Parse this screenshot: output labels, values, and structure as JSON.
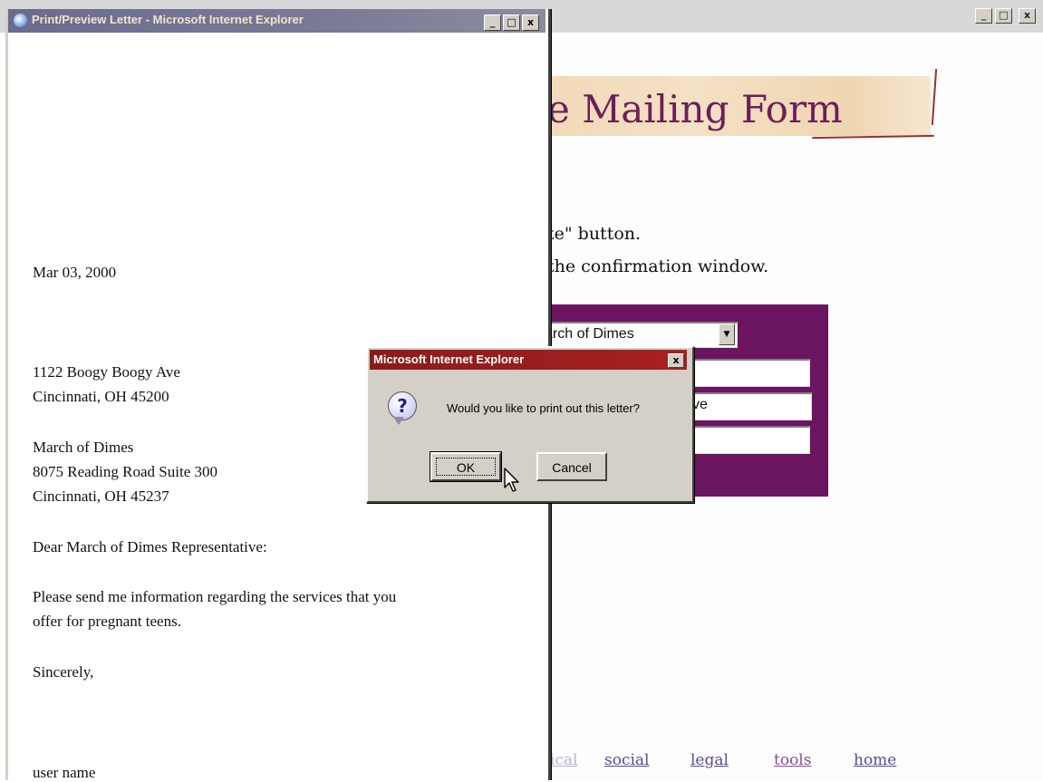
{
  "main_window": {
    "controls": {
      "minimize": "_",
      "maximize": "□",
      "close": "x"
    },
    "banner_title": "e Mailing Form",
    "instructions": [
      "te\" button.",
      "the confirmation window."
    ],
    "form": {
      "organization_select": "arch of Dimes",
      "field_2_value": "ve"
    },
    "nav_links": [
      "dical",
      "social",
      "legal",
      "tools",
      "home"
    ],
    "colors": {
      "form_background": "#6b1460",
      "banner_title": "#6b1f57",
      "link": "#5a4a9a",
      "link_visited": "#8a4aa0"
    }
  },
  "popup": {
    "title": "Print/Preview Letter - Microsoft Internet Explorer",
    "controls": {
      "minimize": "_",
      "maximize": "□",
      "close": "x"
    },
    "letter": {
      "date": "Mar 03, 2000",
      "sender_line1": "1122 Boogy Boogy Ave",
      "sender_line2": "Cincinnati, OH 45200",
      "recipient_line1": "March of Dimes",
      "recipient_line2": "8075 Reading Road Suite 300",
      "recipient_line3": "Cincinnati, OH 45237",
      "salutation": "Dear March of Dimes Representative:",
      "body_line1": "Please send me information regarding the services that you",
      "body_line2": "offer for pregnant teens.",
      "closing": "Sincerely,",
      "signature": "user name"
    }
  },
  "dialog": {
    "title": "Microsoft Internet Explorer",
    "icon": "question-icon",
    "message": "Would you like to print out this letter?",
    "ok_label": "OK",
    "cancel_label": "Cancel",
    "close": "x"
  }
}
